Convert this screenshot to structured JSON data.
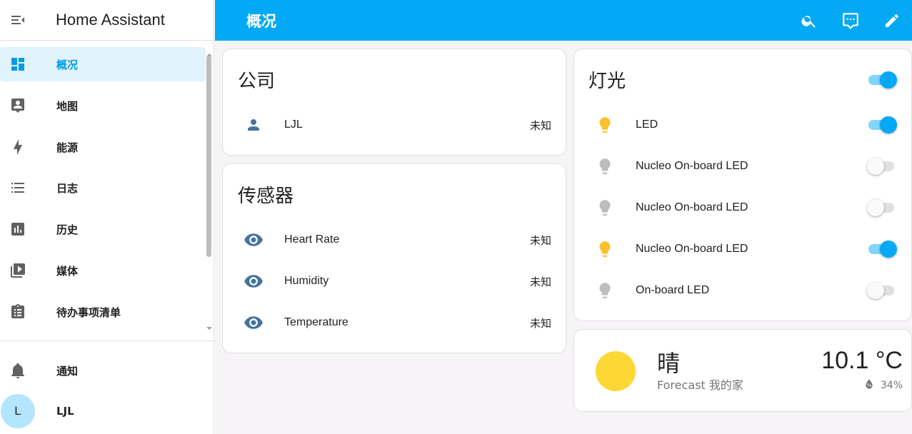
{
  "app": {
    "title": "Home Assistant"
  },
  "header": {
    "title": "概况",
    "actions": [
      {
        "icon": "search-icon"
      },
      {
        "icon": "assist-chat-icon"
      },
      {
        "icon": "pencil-edit-icon"
      }
    ]
  },
  "sidebar": {
    "items": [
      {
        "label": "概况",
        "icon": "dashboard-icon",
        "active": true
      },
      {
        "label": "地图",
        "icon": "map-account-icon"
      },
      {
        "label": "能源",
        "icon": "lightning-icon"
      },
      {
        "label": "日志",
        "icon": "logbook-list-icon"
      },
      {
        "label": "历史",
        "icon": "history-chart-icon"
      },
      {
        "label": "媒体",
        "icon": "media-play-icon"
      },
      {
        "label": "待办事项清单",
        "icon": "todo-clipboard-icon"
      }
    ],
    "notifications_label": "通知",
    "user": {
      "label": "LJL",
      "initial": "L"
    }
  },
  "cards": {
    "company": {
      "title": "公司",
      "rows": [
        {
          "name": "LJL",
          "state": "未知",
          "icon": "person-icon"
        }
      ]
    },
    "sensors": {
      "title": "传感器",
      "rows": [
        {
          "name": "Heart Rate",
          "state": "未知",
          "icon": "eye-icon"
        },
        {
          "name": "Humidity",
          "state": "未知",
          "icon": "eye-icon"
        },
        {
          "name": "Temperature",
          "state": "未知",
          "icon": "eye-icon"
        }
      ]
    },
    "lights": {
      "title": "灯光",
      "master_on": true,
      "rows": [
        {
          "name": "LED",
          "on": true
        },
        {
          "name": "Nucleo On-board LED",
          "on": false
        },
        {
          "name": "Nucleo On-board LED",
          "on": false
        },
        {
          "name": "Nucleo On-board LED",
          "on": true
        },
        {
          "name": "On-board LED",
          "on": false
        }
      ]
    },
    "weather": {
      "condition": "晴",
      "subtitle": "Forecast 我的家",
      "temperature": "10.1 °C",
      "humidity": "34%",
      "icon": "sunny-icon"
    }
  },
  "colors": {
    "accent": "#03a9f4",
    "light_on": "#fbc02d",
    "light_off": "#bdbdbd",
    "entity_icon": "#44739e",
    "sun": "#fdd835"
  }
}
